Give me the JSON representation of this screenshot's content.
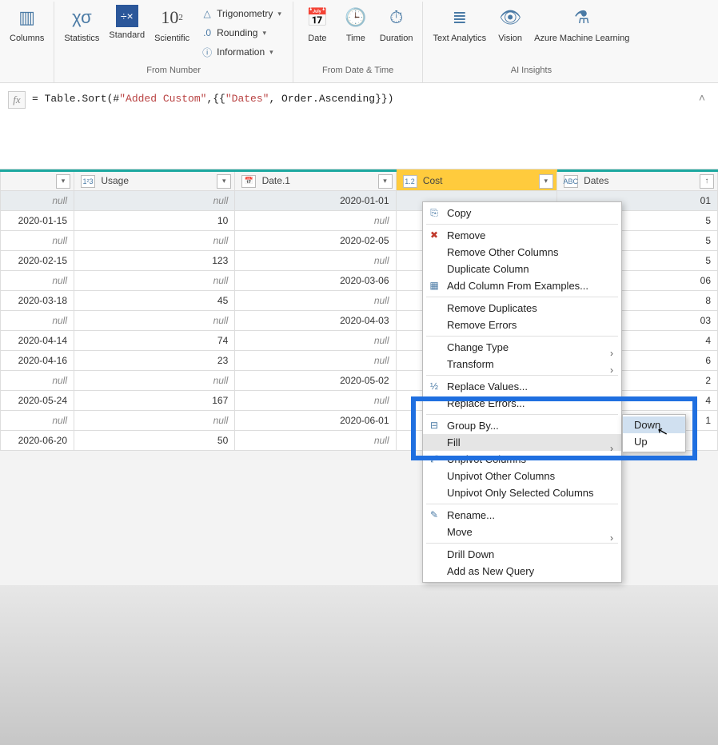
{
  "ribbon": {
    "columns_label": "Columns",
    "from_number": {
      "label": "From Number",
      "statistics": "Statistics",
      "standard": "Standard",
      "scientific": "Scientific",
      "trig": "Trigonometry",
      "rounding": "Rounding",
      "info": "Information"
    },
    "from_datetime": {
      "label": "From Date & Time",
      "date": "Date",
      "time": "Time",
      "duration": "Duration"
    },
    "ai": {
      "label": "AI Insights",
      "text": "Text Analytics",
      "vision": "Vision",
      "aml": "Azure Machine Learning"
    }
  },
  "formula": {
    "prefix": "= Table.Sort(#",
    "str1": "\"Added Custom\"",
    "mid": ",{{",
    "str2": "\"Dates\"",
    "suffix": ", Order.Ascending}})"
  },
  "columns": {
    "usage_type": "1²3",
    "usage": "Usage",
    "date1": "Date.1",
    "cost_type": "1.2",
    "cost": "Cost",
    "dates_type": "ABC",
    "dates": "Dates"
  },
  "rows": [
    {
      "c0": "null",
      "usage": "null",
      "date1": "2020-01-01",
      "cost": "",
      "dates": "01"
    },
    {
      "c0": "2020-01-15",
      "usage": "10",
      "date1": "null",
      "cost": "",
      "dates": "5"
    },
    {
      "c0": "null",
      "usage": "null",
      "date1": "2020-02-05",
      "cost": "",
      "dates": "5"
    },
    {
      "c0": "2020-02-15",
      "usage": "123",
      "date1": "null",
      "cost": "",
      "dates": "5"
    },
    {
      "c0": "null",
      "usage": "null",
      "date1": "2020-03-06",
      "cost": "",
      "dates": "06"
    },
    {
      "c0": "2020-03-18",
      "usage": "45",
      "date1": "null",
      "cost": "",
      "dates": "8"
    },
    {
      "c0": "null",
      "usage": "null",
      "date1": "2020-04-03",
      "cost": "",
      "dates": "03"
    },
    {
      "c0": "2020-04-14",
      "usage": "74",
      "date1": "null",
      "cost": "",
      "dates": "4"
    },
    {
      "c0": "2020-04-16",
      "usage": "23",
      "date1": "null",
      "cost": "",
      "dates": "6"
    },
    {
      "c0": "null",
      "usage": "null",
      "date1": "2020-05-02",
      "cost": "",
      "dates": "2"
    },
    {
      "c0": "2020-05-24",
      "usage": "167",
      "date1": "null",
      "cost": "",
      "dates": "4"
    },
    {
      "c0": "null",
      "usage": "null",
      "date1": "2020-06-01",
      "cost": "",
      "dates": "1"
    },
    {
      "c0": "2020-06-20",
      "usage": "50",
      "date1": "null",
      "cost": "",
      "dates": ""
    }
  ],
  "menu": {
    "copy": "Copy",
    "remove": "Remove",
    "remove_other": "Remove Other Columns",
    "duplicate": "Duplicate Column",
    "add_examples": "Add Column From Examples...",
    "remove_dup": "Remove Duplicates",
    "remove_err": "Remove Errors",
    "change_type": "Change Type",
    "transform": "Transform",
    "replace_vals": "Replace Values...",
    "replace_err": "Replace Errors...",
    "group_by": "Group By...",
    "fill": "Fill",
    "unpivot": "Unpivot Columns",
    "unpivot_other": "Unpivot Other Columns",
    "unpivot_sel": "Unpivot Only Selected Columns",
    "rename": "Rename...",
    "move": "Move",
    "drill": "Drill Down",
    "add_new": "Add as New Query"
  },
  "submenu": {
    "down": "Down",
    "up": "Up"
  }
}
